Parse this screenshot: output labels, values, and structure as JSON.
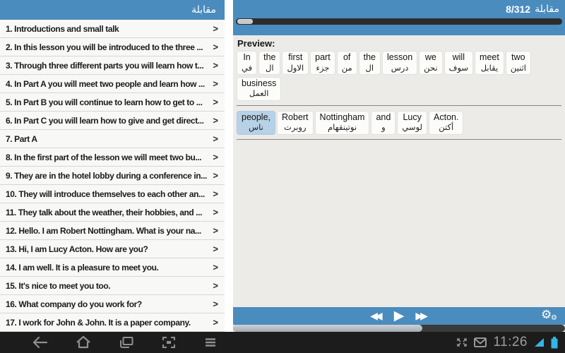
{
  "app": {
    "accent_blue": "#4a8cbe",
    "holo_blue": "#33b5e5"
  },
  "left_panel": {
    "title": "مقابلة",
    "chevron": ">",
    "items": [
      "1. Introductions and small talk",
      "2. In this lesson you will be introduced to the three ...",
      "3. Through three different parts you will learn how t...",
      "4. In Part A you will meet two people and learn how ...",
      "5. In Part B you will continue to learn how to get to ...",
      "6. In Part C you will learn how to give and get direct...",
      "7. Part A",
      "8. In the first part of the lesson we will meet two bu...",
      "9. They are in the hotel lobby during a conference in...",
      "10. They will introduce themselves to each other an...",
      "11. They talk about the weather, their hobbies, and ...",
      "12. Hello. I am Robert Nottingham. What is your na...",
      "13. Hi, I am Lucy Acton. How are you?",
      "14. I am well. It is a pleasure to meet you.",
      "15. It's nice to meet you too.",
      "16. What company do you work for?",
      "17. I work for John & John. It is a paper company."
    ]
  },
  "right_panel": {
    "title_number": "8/312",
    "title_text": "مقابلة",
    "preview_label": "Preview:",
    "sentence_rows": [
      {
        "words": [
          {
            "en": "In",
            "ar": "في"
          },
          {
            "en": "the",
            "ar": "ال"
          },
          {
            "en": "first",
            "ar": "الاول"
          },
          {
            "en": "part",
            "ar": "جزء"
          },
          {
            "en": "of",
            "ar": "من"
          },
          {
            "en": "the",
            "ar": "ال"
          },
          {
            "en": "lesson",
            "ar": "درس"
          },
          {
            "en": "we",
            "ar": "نحن"
          },
          {
            "en": "will",
            "ar": "سوف"
          },
          {
            "en": "meet",
            "ar": "يقابل"
          },
          {
            "en": "two",
            "ar": "اثنين"
          },
          {
            "en": "business",
            "ar": "العمل"
          }
        ]
      },
      {
        "words": [
          {
            "en": "people,",
            "ar": "ناس",
            "highlighted": true
          },
          {
            "en": "Robert",
            "ar": "روبرت"
          },
          {
            "en": "Nottingham",
            "ar": "نوتينقهام"
          },
          {
            "en": "and",
            "ar": "و"
          },
          {
            "en": "Lucy",
            "ar": "لوسي"
          },
          {
            "en": "Acton.",
            "ar": "أكتن"
          }
        ]
      }
    ],
    "player": {
      "rewind_icon": "◀◀",
      "play_icon": "▶",
      "forward_icon": "▶▶",
      "settings_icon": "⚙"
    },
    "progress_percent": 57
  },
  "system_bar": {
    "time": "11:26"
  }
}
